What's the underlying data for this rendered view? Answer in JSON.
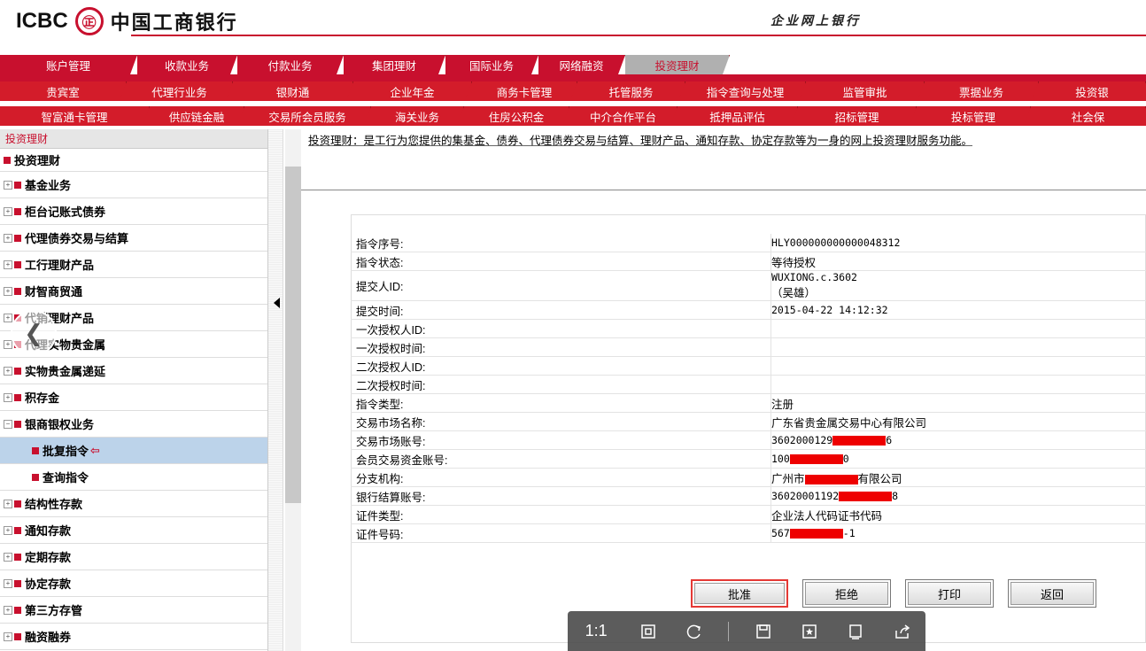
{
  "header": {
    "logo_en": "ICBC",
    "logo_mark": "㊣",
    "logo_cn": "中国工商银行",
    "right_title": "企业网上银行"
  },
  "nav": {
    "row1": [
      {
        "label": "账户管理",
        "active": false
      },
      {
        "label": "收款业务",
        "active": false
      },
      {
        "label": "付款业务",
        "active": false
      },
      {
        "label": "集团理财",
        "active": false
      },
      {
        "label": "国际业务",
        "active": false
      },
      {
        "label": "网络融资",
        "active": false
      },
      {
        "label": "投资理财",
        "active": true
      }
    ],
    "row2": [
      "贵宾室",
      "代理行业务",
      "银财通",
      "企业年金",
      "商务卡管理",
      "托管服务",
      "指令查询与处理",
      "监管审批",
      "票据业务",
      "投资银"
    ],
    "row3": [
      "智富通卡管理",
      "供应链金融",
      "交易所会员服务",
      "海关业务",
      "住房公积金",
      "中介合作平台",
      "抵押品评估",
      "招标管理",
      "投标管理",
      "社会保"
    ]
  },
  "sidebar": {
    "header": "投资理财",
    "root": "投资理财",
    "items": [
      "基金业务",
      "柜台记账式债券",
      "代理债券交易与结算",
      "工行理财产品",
      "财智商贸通",
      "代销理财产品",
      "代理实物贵金属",
      "实物贵金属递延",
      "积存金",
      "银商银权业务"
    ],
    "sub_items": [
      "批复指令",
      "查询指令"
    ],
    "items_after": [
      "结构性存款",
      "通知存款",
      "定期存款",
      "协定存款",
      "第三方存管",
      "融资融券"
    ]
  },
  "content": {
    "description": "投资理财：是工行为您提供的集基金、债券、代理债券交易与结算、理财产品、通知存款、协定存款等为一身的网上投资理财服务功能。"
  },
  "detail": [
    {
      "label": "指令序号:",
      "value": "HLY000000000000048312"
    },
    {
      "label": "指令状态:",
      "value": "等待授权"
    },
    {
      "label": "提交人ID:",
      "value": "WUXIONG.c.3602",
      "value2": "（吴雄）"
    },
    {
      "label": "提交时间:",
      "value": "2015-04-22 14:12:32"
    },
    {
      "label": "一次授权人ID:",
      "value": ""
    },
    {
      "label": "一次授权时间:",
      "value": ""
    },
    {
      "label": "二次授权人ID:",
      "value": ""
    },
    {
      "label": "二次授权时间:",
      "value": ""
    },
    {
      "label": "指令类型:",
      "value": "注册"
    },
    {
      "label": "交易市场名称:",
      "value": "广东省贵金属交易中心有限公司"
    },
    {
      "label": "交易市场账号:",
      "value_a": "3602000129",
      "value_b": "6"
    },
    {
      "label": "会员交易资金账号:",
      "value_a": "100",
      "value_b": "0"
    },
    {
      "label": "分支机构:",
      "value_a": "广州市",
      "value_b": "有限公司"
    },
    {
      "label": "银行结算账号:",
      "value_a": "36020001192",
      "value_b": "8"
    },
    {
      "label": "证件类型:",
      "value": "企业法人代码证书代码"
    },
    {
      "label": "证件号码:",
      "value_a": "567",
      "value_b": "-1"
    }
  ],
  "buttons": {
    "approve": "批准",
    "reject": "拒绝",
    "print": "打印",
    "back": "返回"
  },
  "viewer": {
    "ratio": "1:1"
  },
  "colors": {
    "brand_red": "#c8102e",
    "nav_red": "#d31c2a",
    "selected_bg": "#bcd3ea"
  }
}
